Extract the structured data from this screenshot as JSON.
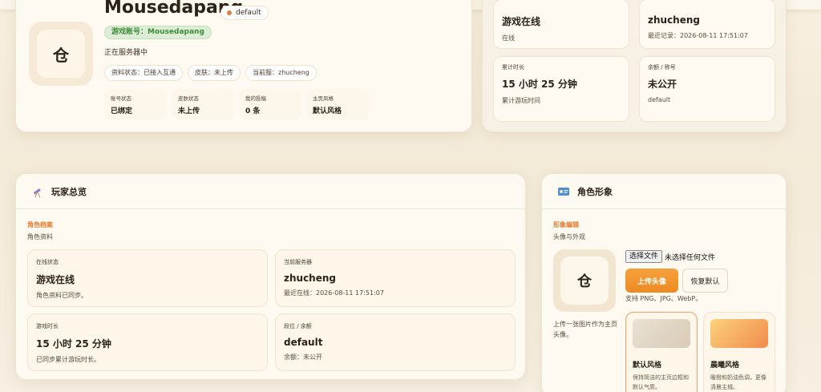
{
  "profile": {
    "name": "Mousedapang",
    "badge": "default",
    "account": "游戏账号：Mousedapang",
    "status": "正在服务器中",
    "chips": [
      "资料状态：已接入互通",
      "皮肤：未上传",
      "当前服：zhucheng"
    ],
    "mini_stats": [
      {
        "label": "账号状态",
        "value": "已绑定"
      },
      {
        "label": "皮肤状态",
        "value": "未上传"
      },
      {
        "label": "我的投稿",
        "value": "0 条"
      },
      {
        "label": "主页风格",
        "value": "默认风格"
      }
    ],
    "avatar_glyph": "仓"
  },
  "summary": {
    "tiles": [
      {
        "label": "",
        "value": "游戏在线",
        "sub": "在线"
      },
      {
        "label": "",
        "value": "zhucheng",
        "sub": "最近记录：2026-08-11 17:51:07"
      },
      {
        "label": "累计时长",
        "value": "15 小时 25 分钟",
        "sub": "累计游玩时间"
      },
      {
        "label": "余额 / 称号",
        "value": "未公开",
        "sub": "default"
      }
    ]
  },
  "overview": {
    "title": "玩家总览",
    "section_title": "角色档案",
    "section_sub": "角色资料",
    "tiles": [
      {
        "label": "在线状态",
        "value": "游戏在线",
        "sub": "角色资料已同步。"
      },
      {
        "label": "当前服务器",
        "value": "zhucheng",
        "sub": "最近在线：2026-08-11 17:51:07"
      },
      {
        "label": "游戏时长",
        "value": "15 小时 25 分钟",
        "sub": "已同步累计游玩时长。"
      },
      {
        "label": "段位 / 余额",
        "value": "default",
        "sub": "余额：未公开"
      }
    ]
  },
  "appearance": {
    "title": "角色形象",
    "section_title": "形象编辑",
    "section_sub": "头像与外观",
    "avatar_glyph": "仓",
    "avatar_note": "上传一张图片作为主页头像。",
    "file_button": "选择文件",
    "file_none": "未选择任何文件",
    "upload_label": "上传头像",
    "reset_label": "恢复默认",
    "support": "支持 PNG、JPG、WebP。",
    "styles": [
      {
        "name": "默认风格",
        "desc": "保持简洁的主页边框和默认气质。",
        "color_a": "#e9e1d4",
        "color_b": "#d8cbb7"
      },
      {
        "name": "晨曦风格",
        "desc": "暖橙和奶油色调，更像清晨主城。",
        "color_a": "#fbd27a",
        "color_b": "#f28a4e"
      }
    ]
  },
  "colors": {
    "accent": "#ee8a22",
    "section_title": "#e77a2c",
    "account_green": "#3f8a3a"
  }
}
